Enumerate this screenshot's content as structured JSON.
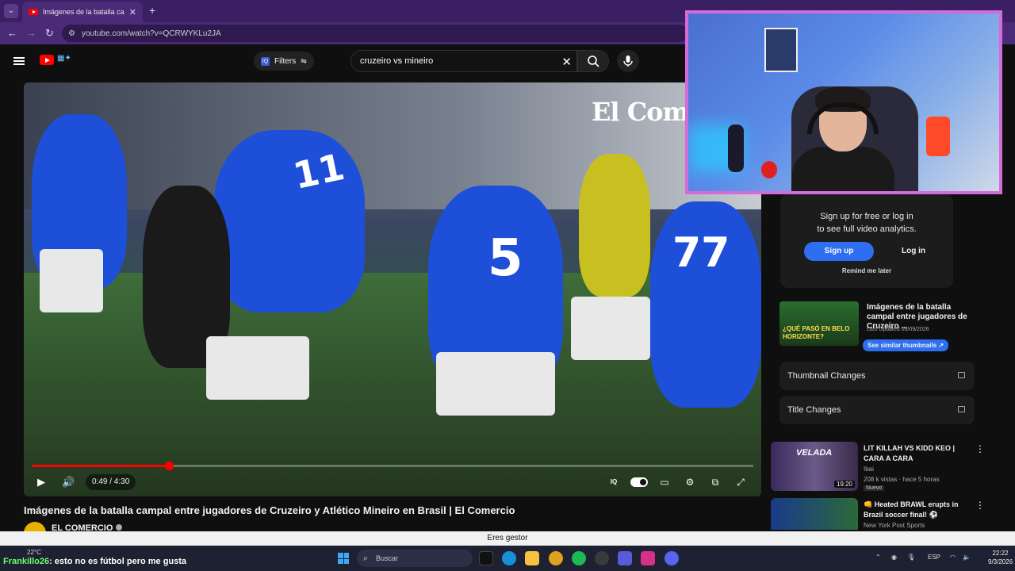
{
  "browser": {
    "tab_title": "Imágenes de la batalla campal e",
    "url": "youtube.com/watch?v=QCRWYKLu2JA"
  },
  "header": {
    "filters_label": "Filters",
    "search_value": "cruzeiro vs mineiro"
  },
  "player": {
    "watermark": "El Comercio",
    "time": "0:49 / 4:30",
    "progress_fraction": 0.19,
    "jersey_numbers": [
      "11",
      "5",
      "77"
    ]
  },
  "video": {
    "title": "Imágenes de la batalla campal entre jugadores de Cruzeiro y Atlético Mineiro en Brasil | El Comercio",
    "channel": "EL COMERCIO"
  },
  "analytics": {
    "signup_text_1": "Sign up for free or log in",
    "signup_text_2": "to see full video analytics.",
    "signup_btn": "Sign up",
    "login_btn": "Log in",
    "remind": "Remind me later",
    "card_title": "Imágenes de la batalla campal entre jugadores de Cruzeiro ...",
    "card_updated": "Last Updated 03/09/2026",
    "card_thumb_text": "¿QUÉ PASÓ EN BELO HORIZONTE?",
    "similar_btn": "See similar thumbnails ↗",
    "thumbnail_changes": "Thumbnail Changes",
    "title_changes": "Title Changes"
  },
  "recommendations": [
    {
      "title": "LIT KILLAH VS KIDD KEO | CARA A CARA",
      "channel": "Ibai",
      "meta": "208 k vistas · hace 5 horas",
      "badge": "Nuevo",
      "duration": "19:20",
      "thumb_text": "VELADA"
    },
    {
      "title": "👊 Heated BRAWL erupts in Brazil soccer final! ⚽",
      "channel": "New York Post Sports",
      "meta": "",
      "badge": "",
      "duration": "",
      "thumb_text": ""
    }
  ],
  "notification": "Eres gestor",
  "taskbar": {
    "weather": "22°C",
    "chat_nick": "Frankillo26",
    "chat_msg": ": esto no es fútbol pero me gusta",
    "search_placeholder": "Buscar",
    "lang": "ESP",
    "time": "22:22",
    "date": "9/3/2026"
  },
  "colors": {
    "accent": "#ff0000",
    "analytics_blue": "#2d6ff0",
    "cam_border": "#d36bd8",
    "chrome_purple": "#4b2a78"
  }
}
